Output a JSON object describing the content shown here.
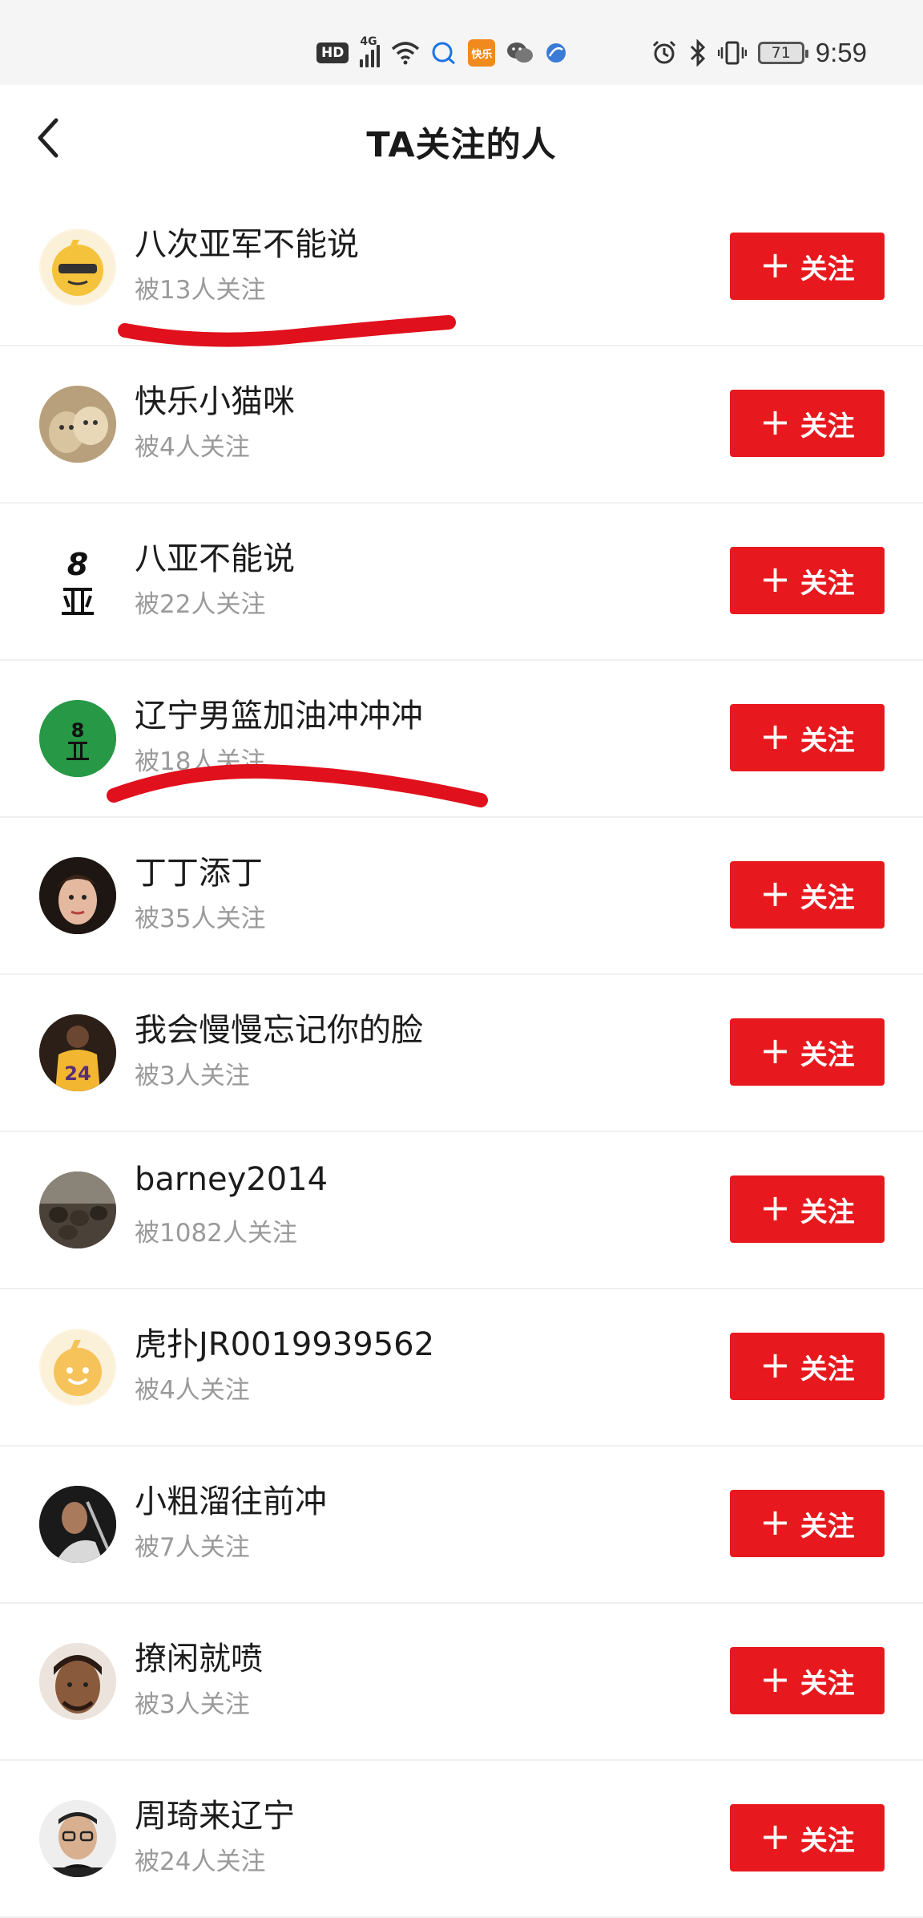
{
  "status_bar": {
    "hd": "HD",
    "network": "4G",
    "app_badge": "快乐",
    "battery": "71",
    "time": "9:59"
  },
  "header": {
    "title": "TA关注的人",
    "back_icon": "chevron-left-icon"
  },
  "follow_label": "关注",
  "users": [
    {
      "name": "八次亚军不能说",
      "followers": "被13人关注",
      "avatar": "emoji-sunglasses"
    },
    {
      "name": "快乐小猫咪",
      "followers": "被4人关注",
      "avatar": "cats-photo"
    },
    {
      "name": "八亚不能说",
      "followers": "被22人关注",
      "avatar": "text-8-ya"
    },
    {
      "name": "辽宁男篮加油冲冲冲",
      "followers": "被18人关注",
      "avatar": "green-8-ya"
    },
    {
      "name": "丁丁添丁",
      "followers": "被35人关注",
      "avatar": "woman-photo"
    },
    {
      "name": "我会慢慢忘记你的脸",
      "followers": "被3人关注",
      "avatar": "jersey-24-photo"
    },
    {
      "name": "barney2014",
      "followers": "被1082人关注",
      "avatar": "animals-photo"
    },
    {
      "name": "虎扑JR0019939562",
      "followers": "被4人关注",
      "avatar": "default-smile"
    },
    {
      "name": "小粗溜往前冲",
      "followers": "被7人关注",
      "avatar": "player-photo"
    },
    {
      "name": "撩闲就喷",
      "followers": "被3人关注",
      "avatar": "man-photo"
    },
    {
      "name": "周琦来辽宁",
      "followers": "被24人关注",
      "avatar": "glasses-man-photo"
    }
  ],
  "colors": {
    "accent": "#e8191e",
    "annotation": "#e0101c"
  }
}
